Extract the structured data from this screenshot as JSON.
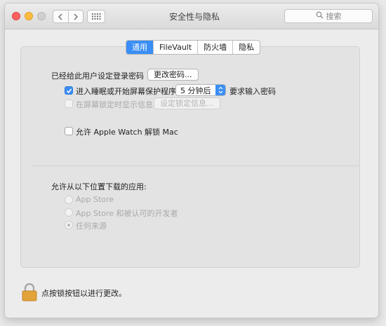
{
  "window": {
    "title": "安全性与隐私",
    "search_placeholder": "搜索",
    "nav_back_icon": "chevron-left-icon",
    "nav_forward_icon": "chevron-right-icon",
    "grid_icon": "grid-icon"
  },
  "tabs": [
    {
      "label": "通用",
      "active": true
    },
    {
      "label": "FileVault",
      "active": false
    },
    {
      "label": "防火墙",
      "active": false
    },
    {
      "label": "隐私",
      "active": false
    }
  ],
  "general": {
    "password_set_label": "已经给此用户设定登录密码",
    "change_password_button": "更改密码...",
    "require_password": {
      "checked": true,
      "label_before": "进入睡眠或开始屏幕保护程序",
      "select_value": "5 分钟后",
      "label_after": "要求输入密码"
    },
    "lock_message": {
      "checked": false,
      "enabled": false,
      "label": "在屏幕锁定时显示信息",
      "button": "设定锁定信息..."
    },
    "apple_watch": {
      "checked": false,
      "label": "允许 Apple Watch 解锁 Mac"
    }
  },
  "downloads": {
    "heading": "允许从以下位置下载的应用:",
    "options": [
      {
        "label": "App Store",
        "selected": false
      },
      {
        "label": "App Store 和被认可的开发者",
        "selected": false
      },
      {
        "label": "任何来源",
        "selected": true
      }
    ]
  },
  "footer": {
    "lock_text": "点按锁按钮以进行更改。",
    "lock_icon": "lock-icon"
  },
  "colors": {
    "accent": "#3a8ef5",
    "lock": "#e2a43a"
  }
}
